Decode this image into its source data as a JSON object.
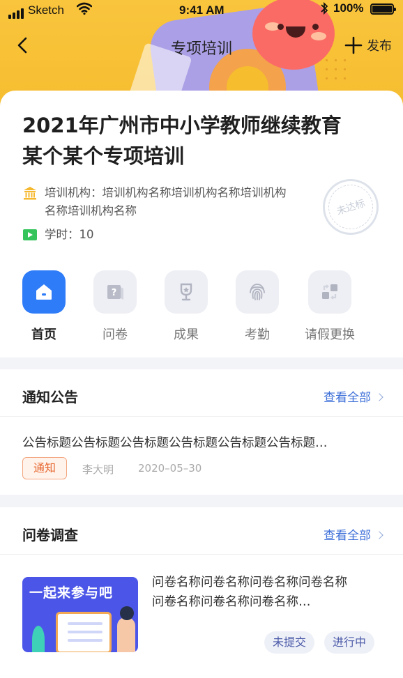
{
  "status_bar": {
    "carrier": "Sketch",
    "time": "9:41 AM",
    "battery": "100%"
  },
  "nav": {
    "title": "专项培训",
    "publish_label": "发布"
  },
  "course": {
    "title_line1": "2021年广州市中小学教师继续教育",
    "title_line2": "某个某个专项培训",
    "org_label": "培训机构：",
    "org_name": "培训机构名称培训机构名称培训机构名称培训机构名称",
    "hours_label": "学时：",
    "hours_value": "10",
    "stamp_text": "未达标"
  },
  "quick_actions": [
    {
      "label": "首页",
      "icon": "home-icon",
      "active": true
    },
    {
      "label": "问卷",
      "icon": "questionnaire-icon",
      "active": false
    },
    {
      "label": "成果",
      "icon": "trophy-icon",
      "active": false
    },
    {
      "label": "考勤",
      "icon": "fingerprint-icon",
      "active": false
    },
    {
      "label": "请假更换",
      "icon": "swap-icon",
      "active": false
    }
  ],
  "notice": {
    "section_title": "通知公告",
    "view_all": "查看全部",
    "item_title": "公告标题公告标题公告标题公告标题公告标题公告标题…",
    "tag": "通知",
    "author": "李大明",
    "date": "2020–05–30"
  },
  "survey": {
    "section_title": "问卷调查",
    "view_all": "查看全部",
    "banner_text": "一起来参与吧",
    "name_line1": "问卷名称问卷名称问卷名称问卷名称",
    "name_line2": "问卷名称问卷名称问卷名称…",
    "status_submit": "未提交",
    "status_progress": "进行中"
  },
  "colors": {
    "accent": "#2f7cf8",
    "hero": "#f9c53d",
    "link": "#3d6fd8",
    "tag": "#e76a33"
  }
}
